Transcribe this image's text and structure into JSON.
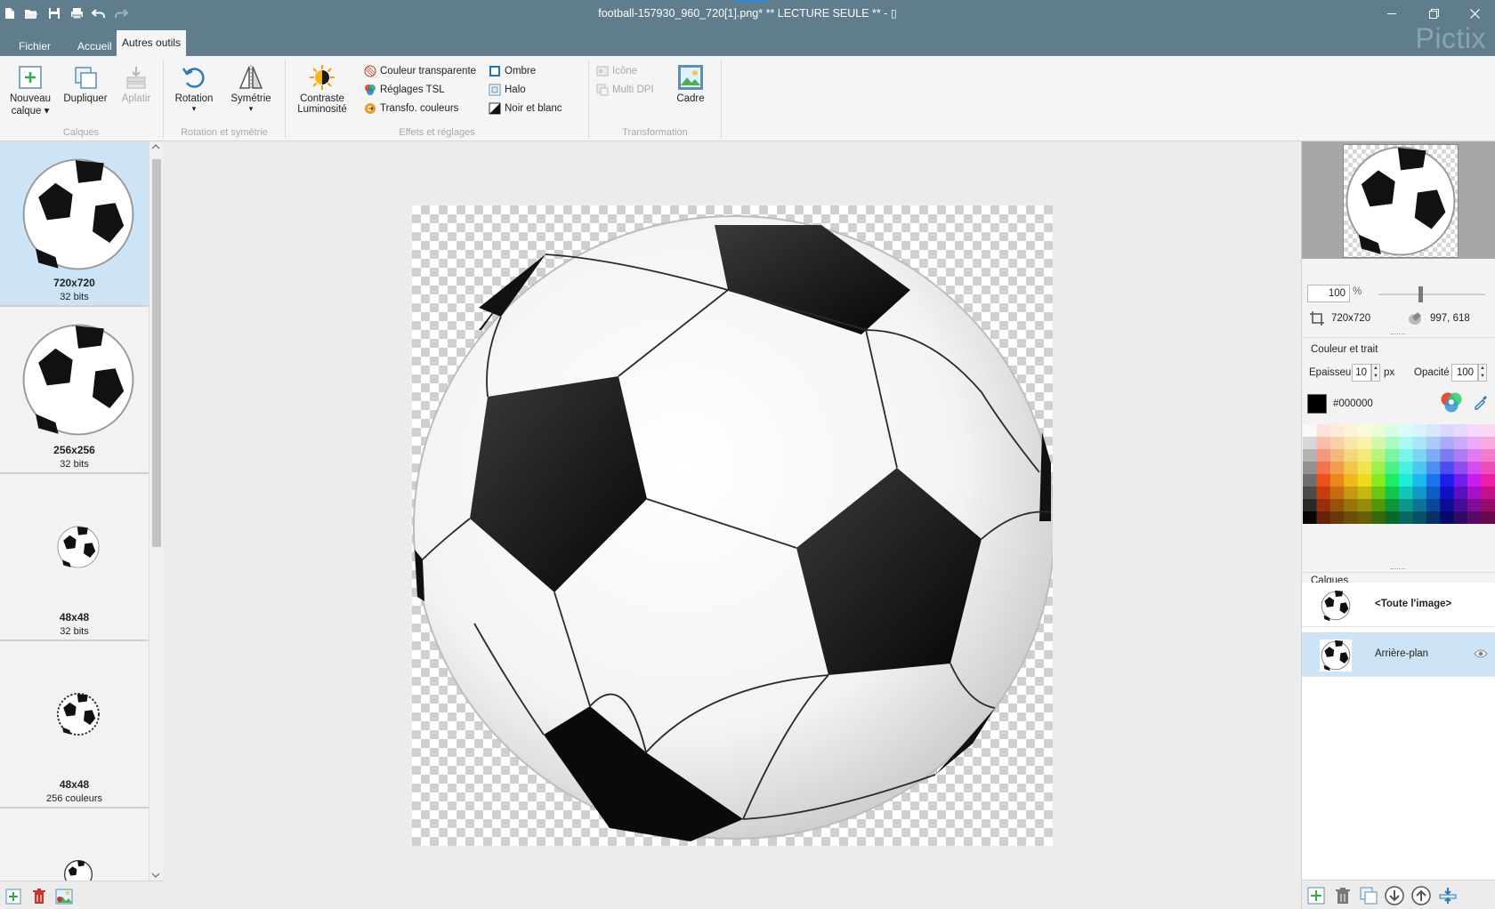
{
  "window": {
    "title": "football-157930_960_720[1].png* ** LECTURE SEULE ** - ▯",
    "brand": "Pictix"
  },
  "tabs": [
    {
      "label": "Fichier",
      "active": false
    },
    {
      "label": "Accueil",
      "active": false
    },
    {
      "label": "Autres outils",
      "active": true
    }
  ],
  "ribbon": {
    "calques": {
      "group_label": "Calques",
      "nouveau_label": "Nouveau",
      "nouveau_label2": "calque ▾",
      "dupliquer_label": "Dupliquer",
      "aplatir_label": "Aplatir"
    },
    "rotation": {
      "group_label": "Rotation et symétrie",
      "rotation_label": "Rotation",
      "symetrie_label": "Symétrie",
      "arrow": "▾"
    },
    "effets": {
      "group_label": "Effets et réglages",
      "contraste_label": "Contraste",
      "luminosite_label": "Luminosité",
      "couleur_transparente": "Couleur transparente",
      "reglages_tsl": "Réglages TSL",
      "transfo_couleurs": "Transfo. couleurs",
      "ombre": "Ombre",
      "halo": "Halo",
      "noir_et_blanc": "Noir et blanc"
    },
    "transformation": {
      "group_label": "Transformation",
      "icone": "Icône",
      "multi_dpi": "Multi DPI",
      "cadre": "Cadre"
    }
  },
  "thumbnails": [
    {
      "size": "720x720",
      "depth": "32 bits",
      "selected": true
    },
    {
      "size": "256x256",
      "depth": "32 bits",
      "selected": false
    },
    {
      "size": "48x48",
      "depth": "32 bits",
      "selected": false
    },
    {
      "size": "48x48",
      "depth": "256 couleurs",
      "selected": false
    }
  ],
  "right_panel": {
    "zoom_value": "100",
    "zoom_unit": "%",
    "image_size": "720x720",
    "cursor_pos": "997, 618",
    "section_color": "Couleur et trait",
    "epaisseur_label": "Epaisseur",
    "epaisseur_value": "10",
    "epaisseur_unit": "px",
    "opacite_label": "Opacité",
    "opacite_value": "100",
    "color_hex": "#000000",
    "layers_title": "Calques",
    "layers": [
      {
        "name": "<Toute l'image>",
        "bold": true,
        "selected": false
      },
      {
        "name": "Arrière-plan",
        "bold": false,
        "selected": true
      }
    ]
  },
  "colors": {
    "titlebar": "#5f7d8c",
    "selection": "#cce4f5",
    "accent_green": "#3aa84a",
    "accent_red": "#c9352b"
  }
}
